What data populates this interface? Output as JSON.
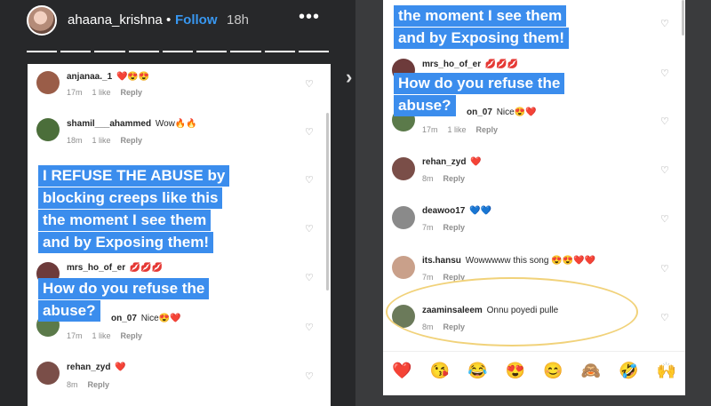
{
  "story": {
    "username": "ahaana_krishna",
    "separator": "•",
    "follow": "Follow",
    "time": "18h",
    "more": "•••",
    "next_arrow": "›"
  },
  "left": {
    "comments": [
      {
        "user": "anjanaa._1",
        "text": "❤️😍😍",
        "age": "17m",
        "likes": "1 like",
        "reply": "Reply"
      },
      {
        "user": "shamil___ahammed",
        "text": "Wow🔥🔥",
        "age": "18m",
        "likes": "1 like",
        "reply": "Reply"
      },
      {
        "user": "mrs_ho_of_er",
        "text": "💋💋💋",
        "age": "",
        "likes": "",
        "reply": ""
      },
      {
        "user": "on_07",
        "text": "Nice😍❤️",
        "age": "17m",
        "likes": "1 like",
        "reply": "Reply"
      },
      {
        "user": "rehan_zyd",
        "text": "❤️",
        "age": "8m",
        "likes": "",
        "reply": "Reply"
      }
    ],
    "caption_lines": [
      "I REFUSE THE ABUSE by",
      "blocking creeps like this",
      "the moment I see them",
      "and by Exposing them!"
    ],
    "question_lines": [
      "How do you refuse the",
      "abuse?"
    ]
  },
  "right": {
    "caption_lines": [
      "the moment I see them",
      "and by Exposing them!"
    ],
    "question_lines": [
      "How do you refuse the",
      "abuse?"
    ],
    "comments": [
      {
        "user": "mrs_ho_of_er",
        "text": "💋💋💋",
        "age": "",
        "likes": "",
        "reply": ""
      },
      {
        "user": "on_07",
        "text": "Nice😍❤️",
        "age": "17m",
        "likes": "1 like",
        "reply": "Reply"
      },
      {
        "user": "rehan_zyd",
        "text": "❤️",
        "age": "8m",
        "likes": "",
        "reply": "Reply"
      },
      {
        "user": "deawoo17",
        "text": "💙💙",
        "age": "7m",
        "likes": "",
        "reply": "Reply"
      },
      {
        "user": "its.hansu",
        "text": "Wowwwww this song 😍😍❤️❤️",
        "age": "7m",
        "likes": "",
        "reply": "Reply"
      },
      {
        "user": "zaaminsaleem",
        "text": "Onnu poyedi pulle",
        "age": "8m",
        "likes": "",
        "reply": "Reply"
      }
    ],
    "emojis": [
      "❤️",
      "😘",
      "😂",
      "😍",
      "😊",
      "🙈",
      "🤣",
      "🙌"
    ]
  },
  "colors": {
    "accent": "#3897f0",
    "caption_bg": "#3b8ded",
    "highlight": "#f1d27a"
  }
}
